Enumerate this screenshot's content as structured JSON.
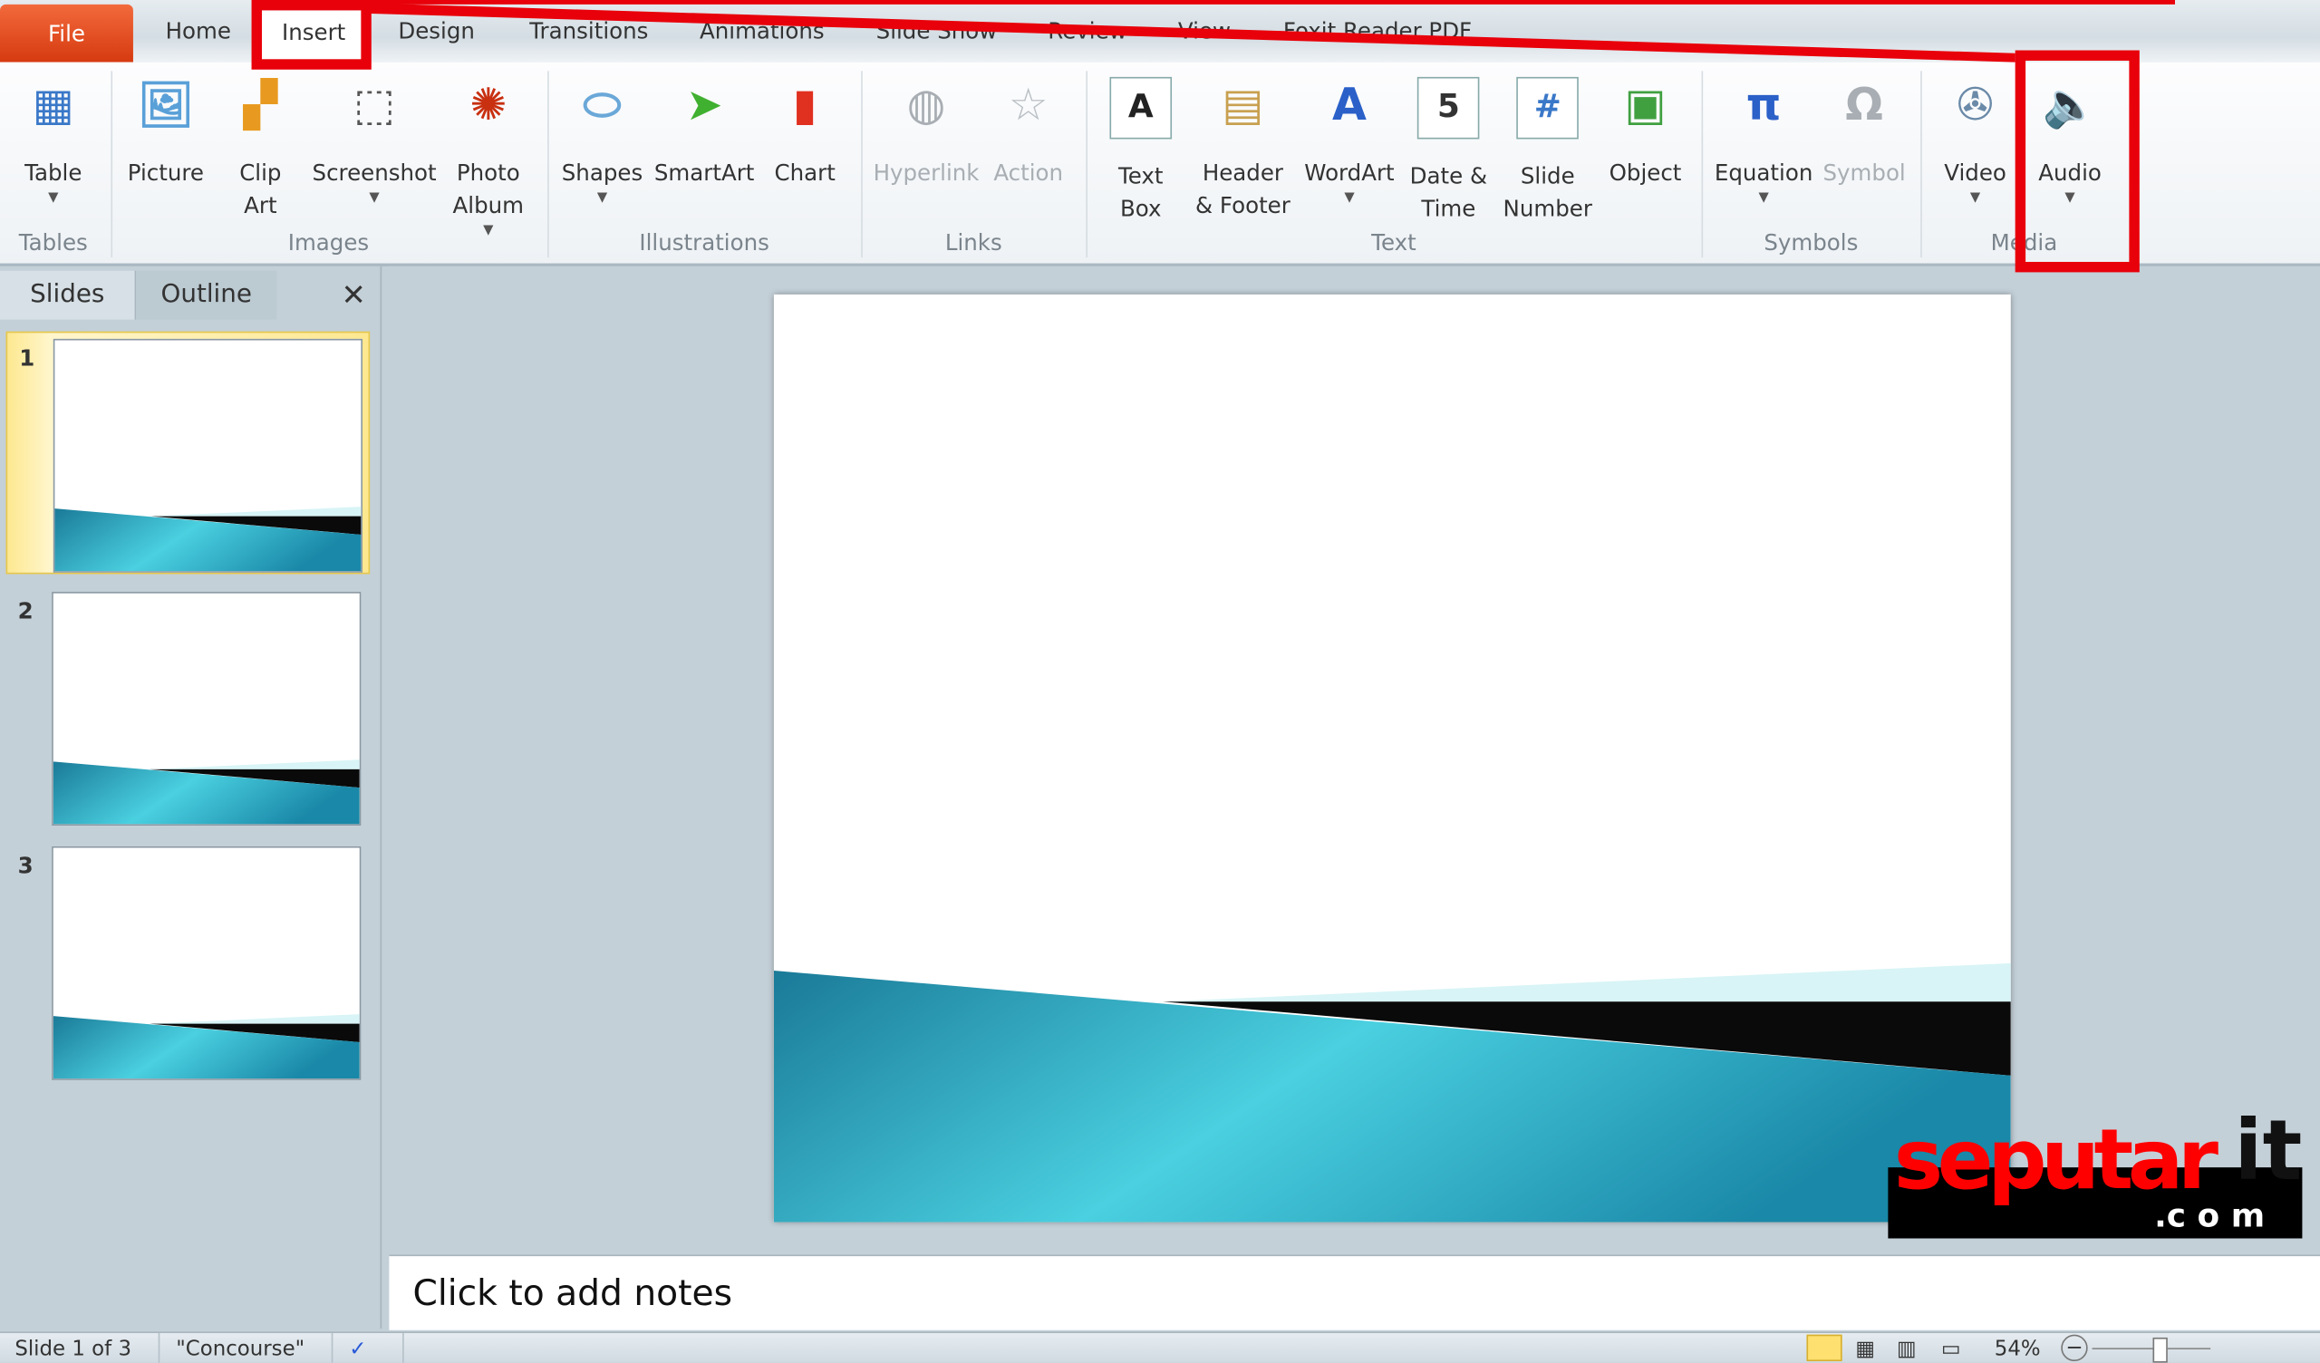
{
  "tabs": [
    "File",
    "Home",
    "Insert",
    "Design",
    "Transitions",
    "Animations",
    "Slide Show",
    "Review",
    "View",
    "Foxit Reader PDF"
  ],
  "active_tab": "Insert",
  "ribbon": {
    "buttons": [
      {
        "label": "Table",
        "label2": "",
        "icon": "table-icon",
        "caret": true,
        "color": "#3a78c8",
        "enabled": true
      },
      {
        "label": "Picture",
        "label2": "",
        "icon": "picture-icon",
        "caret": false,
        "color": "#5aa0d8",
        "enabled": true
      },
      {
        "label": "Clip",
        "label2": "Art",
        "icon": "clip-art-icon",
        "caret": false,
        "color": "#e89a20",
        "enabled": true
      },
      {
        "label": "Screenshot",
        "label2": "",
        "icon": "screenshot-icon",
        "caret": true,
        "color": "#555555",
        "enabled": true
      },
      {
        "label": "Photo",
        "label2": "Album",
        "icon": "photo-album-icon",
        "caret": true,
        "color": "#c83010",
        "enabled": true
      },
      {
        "label": "Shapes",
        "label2": "",
        "icon": "shapes-icon",
        "caret": true,
        "color": "#6aa8d8",
        "enabled": true
      },
      {
        "label": "SmartArt",
        "label2": "",
        "icon": "smartart-icon",
        "caret": false,
        "color": "#40b030",
        "enabled": true
      },
      {
        "label": "Chart",
        "label2": "",
        "icon": "chart-icon",
        "caret": false,
        "color": "#e03020",
        "enabled": true
      },
      {
        "label": "Hyperlink",
        "label2": "",
        "icon": "hyperlink-icon",
        "caret": false,
        "color": "#a8aeb3",
        "enabled": false
      },
      {
        "label": "Action",
        "label2": "",
        "icon": "action-icon",
        "caret": false,
        "color": "#b8bec3",
        "enabled": false
      },
      {
        "label": "Text",
        "label2": "Box",
        "icon": "text-box-icon",
        "caret": false,
        "color": "#222222",
        "enabled": true
      },
      {
        "label": "Header",
        "label2": "& Footer",
        "icon": "header-footer-icon",
        "caret": false,
        "color": "#c8a050",
        "enabled": true
      },
      {
        "label": "WordArt",
        "label2": "",
        "icon": "wordart-icon",
        "caret": true,
        "color": "#2a60c8",
        "enabled": true
      },
      {
        "label": "Date &",
        "label2": "Time",
        "icon": "date-time-icon",
        "caret": false,
        "color": "#333333",
        "enabled": true
      },
      {
        "label": "Slide",
        "label2": "Number",
        "icon": "slide-number-icon",
        "caret": false,
        "color": "#3a78c8",
        "enabled": true
      },
      {
        "label": "Object",
        "label2": "",
        "icon": "object-icon",
        "caret": false,
        "color": "#40a040",
        "enabled": true
      },
      {
        "label": "Equation",
        "label2": "",
        "icon": "equation-icon",
        "caret": true,
        "color": "#2a60c8",
        "enabled": true
      },
      {
        "label": "Symbol",
        "label2": "",
        "icon": "symbol-icon",
        "caret": false,
        "color": "#a8aeb3",
        "enabled": false
      },
      {
        "label": "Video",
        "label2": "",
        "icon": "video-icon",
        "caret": true,
        "color": "#6a8aa8",
        "enabled": true
      },
      {
        "label": "Audio",
        "label2": "",
        "icon": "audio-icon",
        "caret": true,
        "color": "#d8a020",
        "enabled": true
      }
    ],
    "groups": [
      "Tables",
      "Images",
      "Illustrations",
      "Links",
      "Text",
      "Symbols",
      "Media"
    ]
  },
  "left_pane": {
    "tabs": [
      "Slides",
      "Outline"
    ],
    "slides": [
      "1",
      "2",
      "3"
    ],
    "selected": "1"
  },
  "notes_placeholder": "Click to add notes",
  "status": {
    "slide": "Slide 1 of 3",
    "theme": "\"Concourse\"",
    "zoom": "54%"
  },
  "watermark": "seputarit.com",
  "colors": {
    "annotation": "#e8000a",
    "file_tab": "#e0441a",
    "slide_teal": "#2aa8c0"
  }
}
